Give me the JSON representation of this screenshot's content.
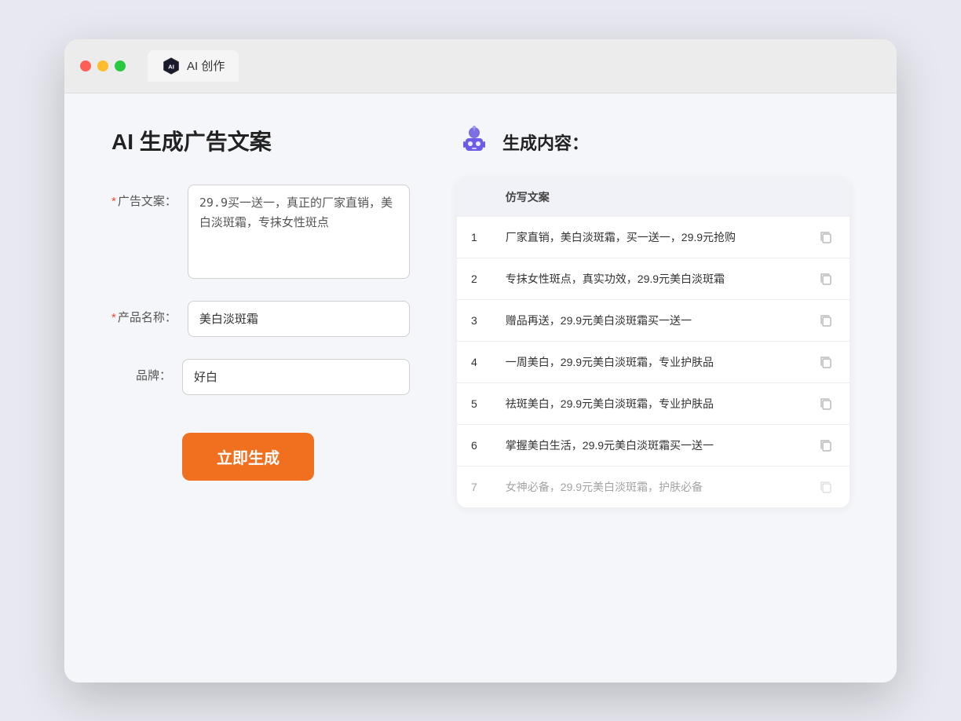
{
  "browser": {
    "tab_label": "AI 创作"
  },
  "left_panel": {
    "title": "AI 生成广告文案",
    "fields": [
      {
        "label": "广告文案：",
        "required": true,
        "type": "textarea",
        "value": "29.9买一送一，真正的厂家直销，美白淡斑霜，专抹女性斑点",
        "name": "ad-copy-textarea"
      },
      {
        "label": "产品名称：",
        "required": true,
        "type": "input",
        "value": "美白淡斑霜",
        "name": "product-name-input"
      },
      {
        "label": "品牌：",
        "required": false,
        "type": "input",
        "value": "好白",
        "name": "brand-input"
      }
    ],
    "button_label": "立即生成"
  },
  "right_panel": {
    "title": "生成内容：",
    "table_header": "仿写文案",
    "results": [
      {
        "num": "1",
        "text": "厂家直销，美白淡斑霜，买一送一，29.9元抢购"
      },
      {
        "num": "2",
        "text": "专抹女性斑点，真实功效，29.9元美白淡斑霜"
      },
      {
        "num": "3",
        "text": "赠品再送，29.9元美白淡斑霜买一送一"
      },
      {
        "num": "4",
        "text": "一周美白，29.9元美白淡斑霜，专业护肤品"
      },
      {
        "num": "5",
        "text": "祛斑美白，29.9元美白淡斑霜，专业护肤品"
      },
      {
        "num": "6",
        "text": "掌握美白生活，29.9元美白淡斑霜买一送一"
      },
      {
        "num": "7",
        "text": "女神必备，29.9元美白淡斑霜，护肤必备"
      }
    ]
  },
  "colors": {
    "accent": "#f07020",
    "required_star": "#e74c3c",
    "robot_body": "#6c5ce7",
    "robot_head": "#a29bfe"
  }
}
